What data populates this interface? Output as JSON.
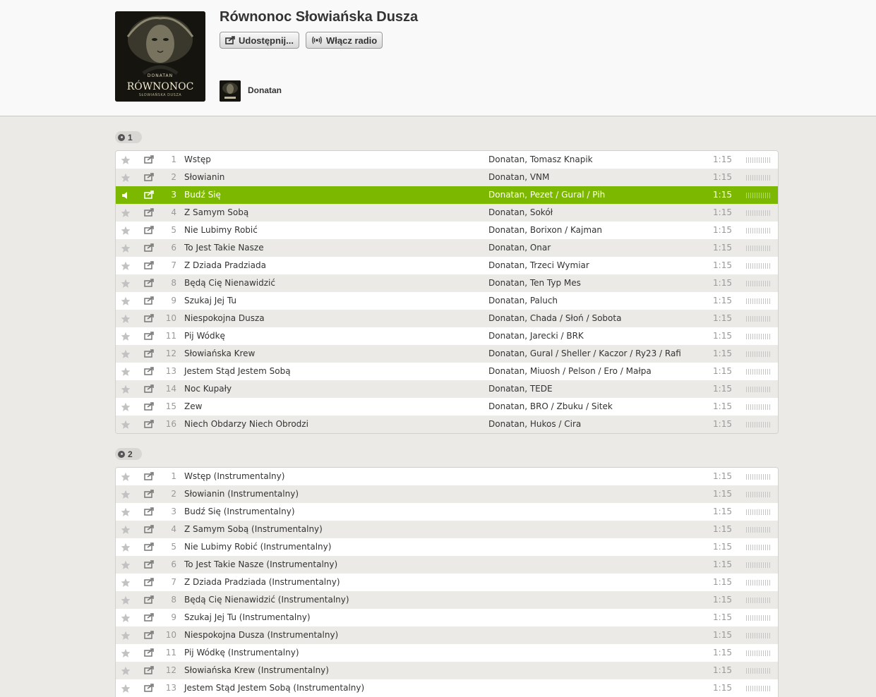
{
  "album": {
    "title": "Równonoc Słowiańska Dusza",
    "cover_text": {
      "artist": "DONATAN",
      "title": "RÓWNONOC",
      "subtitle": "SŁOWIAŃSKA DUSZA"
    }
  },
  "buttons": {
    "share_label": "Udostępnij...",
    "radio_label": "Włącz radio"
  },
  "artist": {
    "name": "Donatan"
  },
  "colors": {
    "accent": "#7db800",
    "row_alt": "#ebeae6",
    "header_bg": "#f9f9f9"
  },
  "icons": {
    "star": "star-icon",
    "share": "share-icon",
    "speaker": "speaker-icon",
    "disc": "disc-icon",
    "radio": "radio-icon"
  },
  "discs": [
    {
      "number": "1",
      "tracks": [
        {
          "num": "1",
          "title": "Wstęp",
          "artists": "Donatan, Tomasz Knapik",
          "duration": "1:15"
        },
        {
          "num": "2",
          "title": "Słowianin",
          "artists": "Donatan, VNM",
          "duration": "1:15"
        },
        {
          "num": "3",
          "title": "Budź Się",
          "artists": "Donatan, Pezet / Gural / Pih",
          "duration": "1:15",
          "playing": true
        },
        {
          "num": "4",
          "title": "Z Samym Sobą",
          "artists": "Donatan, Sokół",
          "duration": "1:15"
        },
        {
          "num": "5",
          "title": "Nie Lubimy Robić",
          "artists": "Donatan, Borixon / Kajman",
          "duration": "1:15"
        },
        {
          "num": "6",
          "title": "To Jest Takie Nasze",
          "artists": "Donatan, Onar",
          "duration": "1:15"
        },
        {
          "num": "7",
          "title": "Z Dziada Pradziada",
          "artists": "Donatan, Trzeci Wymiar",
          "duration": "1:15"
        },
        {
          "num": "8",
          "title": "Będą Cię Nienawidzić",
          "artists": "Donatan, Ten Typ Mes",
          "duration": "1:15"
        },
        {
          "num": "9",
          "title": "Szukaj Jej Tu",
          "artists": "Donatan, Paluch",
          "duration": "1:15"
        },
        {
          "num": "10",
          "title": "Niespokojna Dusza",
          "artists": "Donatan, Chada / Słoń / Sobota",
          "duration": "1:15"
        },
        {
          "num": "11",
          "title": "Pij Wódkę",
          "artists": "Donatan, Jarecki / BRK",
          "duration": "1:15"
        },
        {
          "num": "12",
          "title": "Słowiańska Krew",
          "artists": "Donatan, Gural / Sheller / Kaczor / Ry23 / Rafi",
          "duration": "1:15"
        },
        {
          "num": "13",
          "title": "Jestem Stąd Jestem Sobą",
          "artists": "Donatan, Miuosh / Pelson / Ero / Małpa",
          "duration": "1:15"
        },
        {
          "num": "14",
          "title": "Noc Kupały",
          "artists": "Donatan, TEDE",
          "duration": "1:15"
        },
        {
          "num": "15",
          "title": "Zew",
          "artists": "Donatan, BRO / Zbuku / Sitek",
          "duration": "1:15"
        },
        {
          "num": "16",
          "title": "Niech Obdarzy Niech Obrodzi",
          "artists": "Donatan, Hukos / Cira",
          "duration": "1:15"
        }
      ]
    },
    {
      "number": "2",
      "tracks": [
        {
          "num": "1",
          "title": "Wstęp (Instrumentalny)",
          "artists": "",
          "duration": "1:15"
        },
        {
          "num": "2",
          "title": "Słowianin (Instrumentalny)",
          "artists": "",
          "duration": "1:15"
        },
        {
          "num": "3",
          "title": "Budź Się (Instrumentalny)",
          "artists": "",
          "duration": "1:15"
        },
        {
          "num": "4",
          "title": "Z Samym Sobą (Instrumentalny)",
          "artists": "",
          "duration": "1:15"
        },
        {
          "num": "5",
          "title": "Nie Lubimy Robić (Instrumentalny)",
          "artists": "",
          "duration": "1:15"
        },
        {
          "num": "6",
          "title": "To Jest Takie Nasze (Instrumentalny)",
          "artists": "",
          "duration": "1:15"
        },
        {
          "num": "7",
          "title": "Z Dziada Pradziada (Instrumentalny)",
          "artists": "",
          "duration": "1:15"
        },
        {
          "num": "8",
          "title": "Będą Cię Nienawidzić (Instrumentalny)",
          "artists": "",
          "duration": "1:15"
        },
        {
          "num": "9",
          "title": "Szukaj Jej Tu (Instrumentalny)",
          "artists": "",
          "duration": "1:15"
        },
        {
          "num": "10",
          "title": "Niespokojna Dusza (Instrumentalny)",
          "artists": "",
          "duration": "1:15"
        },
        {
          "num": "11",
          "title": "Pij Wódkę (Instrumentalny)",
          "artists": "",
          "duration": "1:15"
        },
        {
          "num": "12",
          "title": "Słowiańska Krew (Instrumentalny)",
          "artists": "",
          "duration": "1:15"
        },
        {
          "num": "13",
          "title": "Jestem Stąd Jestem Sobą (Instrumentalny)",
          "artists": "",
          "duration": "1:15"
        }
      ]
    }
  ]
}
